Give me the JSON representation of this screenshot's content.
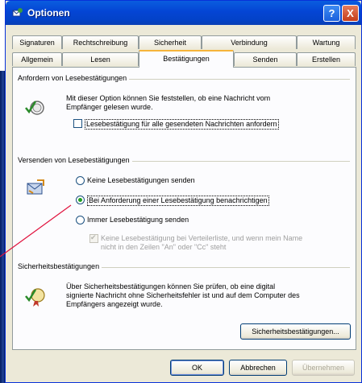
{
  "window": {
    "title": "Optionen"
  },
  "titlebar_buttons": {
    "help": "?",
    "close": "X"
  },
  "tabs_row1": [
    "Signaturen",
    "Rechtschreibung",
    "Sicherheit",
    "Verbindung",
    "Wartung"
  ],
  "tabs_row2": [
    "Allgemein",
    "Lesen",
    "Bestätigungen",
    "Senden",
    "Erstellen"
  ],
  "active_tab": "Bestätigungen",
  "request_section": {
    "title": "Anfordern von Lesebestätigungen",
    "description_line1": "Mit dieser Option können Sie feststellen, ob eine Nachricht vom",
    "description_line2": "Empfänger gelesen wurde.",
    "checkbox_label": "Lesebestätigung für alle gesendeten Nachrichten anfordern",
    "checkbox_checked": false
  },
  "send_section": {
    "title": "Versenden von Lesebestätigungen",
    "options": [
      "Keine Lesebestätigungen senden",
      "Bei Anforderung einer Lesebestätigung benachrichtigen",
      "Immer Lesebestätigung senden"
    ],
    "selected_option": "Bei Anforderung einer Lesebestätigung benachrichtigen",
    "sub_checkbox_line1": "Keine Lesebestätigung bei Verteilerliste, und wenn mein Name",
    "sub_checkbox_line2": "nicht in den Zeilen \"An\" oder \"Cc\" steht",
    "sub_checkbox_checked": true
  },
  "security_section": {
    "title": "Sicherheitsbestätigungen",
    "description_line1": "Über Sicherheitsbestätigungen können Sie prüfen, ob eine digital",
    "description_line2": "signierte Nachricht ohne Sicherheitsfehler ist und auf dem Computer des",
    "description_line3": "Empfängers angezeigt wurde.",
    "button_label": "Sicherheitsbestätigungen..."
  },
  "footer_buttons": {
    "ok": "OK",
    "cancel": "Abbrechen",
    "apply": "Übernehmen"
  },
  "colors": {
    "titlebar": "#0445d4",
    "accent_tab": "#f6b43a",
    "annotation_line": "#e0103c",
    "radio_dot": "#21a121"
  }
}
